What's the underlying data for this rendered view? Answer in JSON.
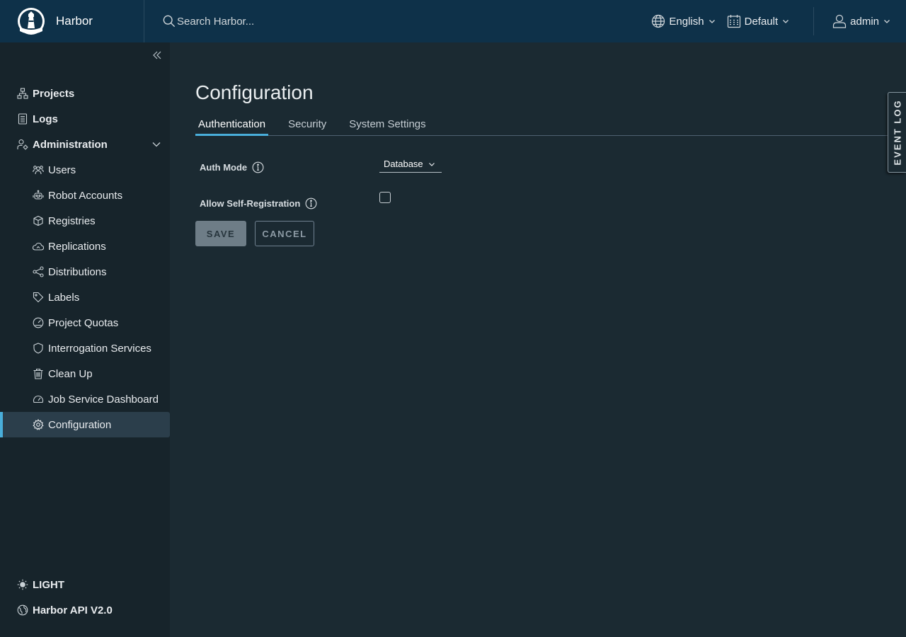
{
  "header": {
    "brand": "Harbor",
    "search_placeholder": "Search Harbor...",
    "language": "English",
    "theme_mode": "Default",
    "user": "admin"
  },
  "sidebar": {
    "top_items": [
      {
        "label": "Projects",
        "icon": "projects-icon"
      },
      {
        "label": "Logs",
        "icon": "logs-icon"
      },
      {
        "label": "Administration",
        "icon": "administration-icon"
      }
    ],
    "admin_items": [
      {
        "label": "Users",
        "icon": "users-icon"
      },
      {
        "label": "Robot Accounts",
        "icon": "robot-icon"
      },
      {
        "label": "Registries",
        "icon": "registries-icon"
      },
      {
        "label": "Replications",
        "icon": "replications-icon"
      },
      {
        "label": "Distributions",
        "icon": "distributions-icon"
      },
      {
        "label": "Labels",
        "icon": "labels-icon"
      },
      {
        "label": "Project Quotas",
        "icon": "quotas-icon"
      },
      {
        "label": "Interrogation Services",
        "icon": "shield-icon"
      },
      {
        "label": "Clean Up",
        "icon": "trash-icon"
      },
      {
        "label": "Job Service Dashboard",
        "icon": "dashboard-icon"
      },
      {
        "label": "Configuration",
        "icon": "gear-icon",
        "active": true
      }
    ],
    "bottom_items": [
      {
        "label": "LIGHT",
        "icon": "sun-icon"
      },
      {
        "label": "Harbor API V2.0",
        "icon": "api-icon"
      }
    ]
  },
  "main": {
    "title": "Configuration",
    "tabs": [
      {
        "label": "Authentication",
        "active": true
      },
      {
        "label": "Security"
      },
      {
        "label": "System Settings"
      }
    ],
    "auth_mode_label": "Auth Mode",
    "auth_mode_value": "Database",
    "self_registration_label": "Allow Self-Registration",
    "self_registration_checked": false,
    "save_label": "SAVE",
    "cancel_label": "CANCEL"
  },
  "event_log_label": "EVENT LOG",
  "colors": {
    "header_bg": "#0e3149",
    "sidebar_bg": "#17242b",
    "main_bg": "#1b2a32",
    "accent": "#49aeda"
  }
}
